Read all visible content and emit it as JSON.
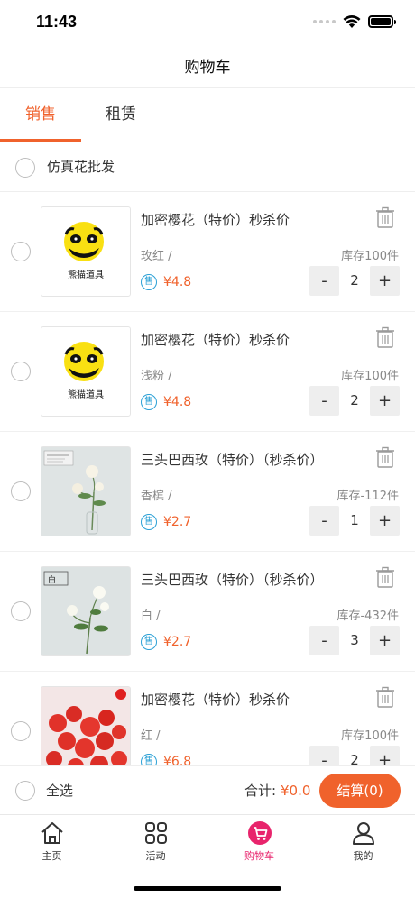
{
  "status_bar": {
    "time": "11:43"
  },
  "nav": {
    "title": "购物车"
  },
  "tabs": [
    {
      "label": "销售",
      "active": true
    },
    {
      "label": "租赁",
      "active": false
    }
  ],
  "shop": {
    "name": "仿真花批发"
  },
  "items": [
    {
      "title": "加密樱花（特价）秒杀价",
      "spec": "玫红 /",
      "stock": "库存100件",
      "badge": "售",
      "price": "¥4.8",
      "qty": "2",
      "minus": "-",
      "plus": "+",
      "image": {
        "kind": "logo",
        "logo_text": "熊猫道具"
      }
    },
    {
      "title": "加密樱花（特价）秒杀价",
      "spec": "浅粉 /",
      "stock": "库存100件",
      "badge": "售",
      "price": "¥4.8",
      "qty": "2",
      "minus": "-",
      "plus": "+",
      "image": {
        "kind": "logo",
        "logo_text": "熊猫道具"
      }
    },
    {
      "title": "三头巴西玫（特价）（秒杀价）",
      "spec": "香槟 /",
      "stock": "库存-112件",
      "badge": "售",
      "price": "¥2.7",
      "qty": "1",
      "minus": "-",
      "plus": "+",
      "image": {
        "kind": "photo-white-rose"
      }
    },
    {
      "title": "三头巴西玫（特价）（秒杀价）",
      "spec": "白 /",
      "stock": "库存-432件",
      "badge": "售",
      "price": "¥2.7",
      "qty": "3",
      "minus": "-",
      "plus": "+",
      "image": {
        "kind": "photo-white-rose",
        "tag": "白"
      }
    },
    {
      "title": "加密樱花（特价）秒杀价",
      "spec": "红 /",
      "stock": "库存100件",
      "badge": "售",
      "price": "¥6.8",
      "qty": "2",
      "minus": "-",
      "plus": "+",
      "image": {
        "kind": "photo-red-blossom"
      }
    }
  ],
  "checkout": {
    "select_all": "全选",
    "total_label": "合计:",
    "total_value": "¥0.0",
    "button": "结算(0)"
  },
  "tabbar": [
    {
      "label": "主页",
      "icon": "home-icon",
      "active": false
    },
    {
      "label": "活动",
      "icon": "grid-icon",
      "active": false
    },
    {
      "label": "购物车",
      "icon": "cart-icon",
      "active": true
    },
    {
      "label": "我的",
      "icon": "user-icon",
      "active": false
    }
  ],
  "colors": {
    "accent": "#f0622c",
    "badge_blue": "#2aa0d6",
    "tab_active": "#e8246c"
  }
}
